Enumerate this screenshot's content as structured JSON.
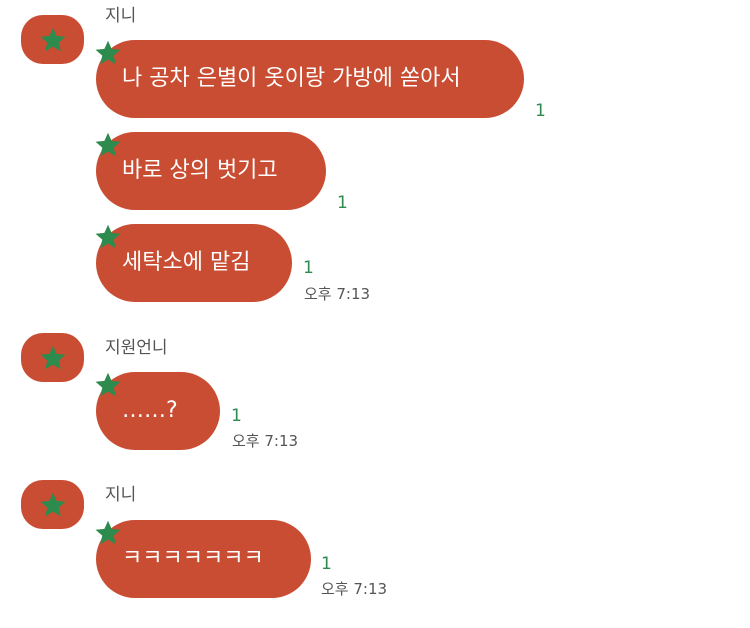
{
  "theme": {
    "bubble_color": "#c94d32",
    "star_color": "#2e8b4e",
    "avatar_icon": "star-icon"
  },
  "groups": [
    {
      "sender": "지니",
      "messages": [
        {
          "text": "나 공차 은별이 옷이랑 가방에 쏟아서",
          "unread": "1"
        },
        {
          "text": "바로 상의 벗기고",
          "unread": "1"
        },
        {
          "text": "세탁소에 맡김",
          "unread": "1",
          "time": "오후 7:13"
        }
      ]
    },
    {
      "sender": "지원언니",
      "messages": [
        {
          "text": "……?",
          "unread": "1",
          "time": "오후 7:13"
        }
      ]
    },
    {
      "sender": "지니",
      "messages": [
        {
          "text": "ㅋㅋㅋㅋㅋㅋㅋ",
          "unread": "1",
          "time": "오후 7:13"
        }
      ]
    }
  ]
}
